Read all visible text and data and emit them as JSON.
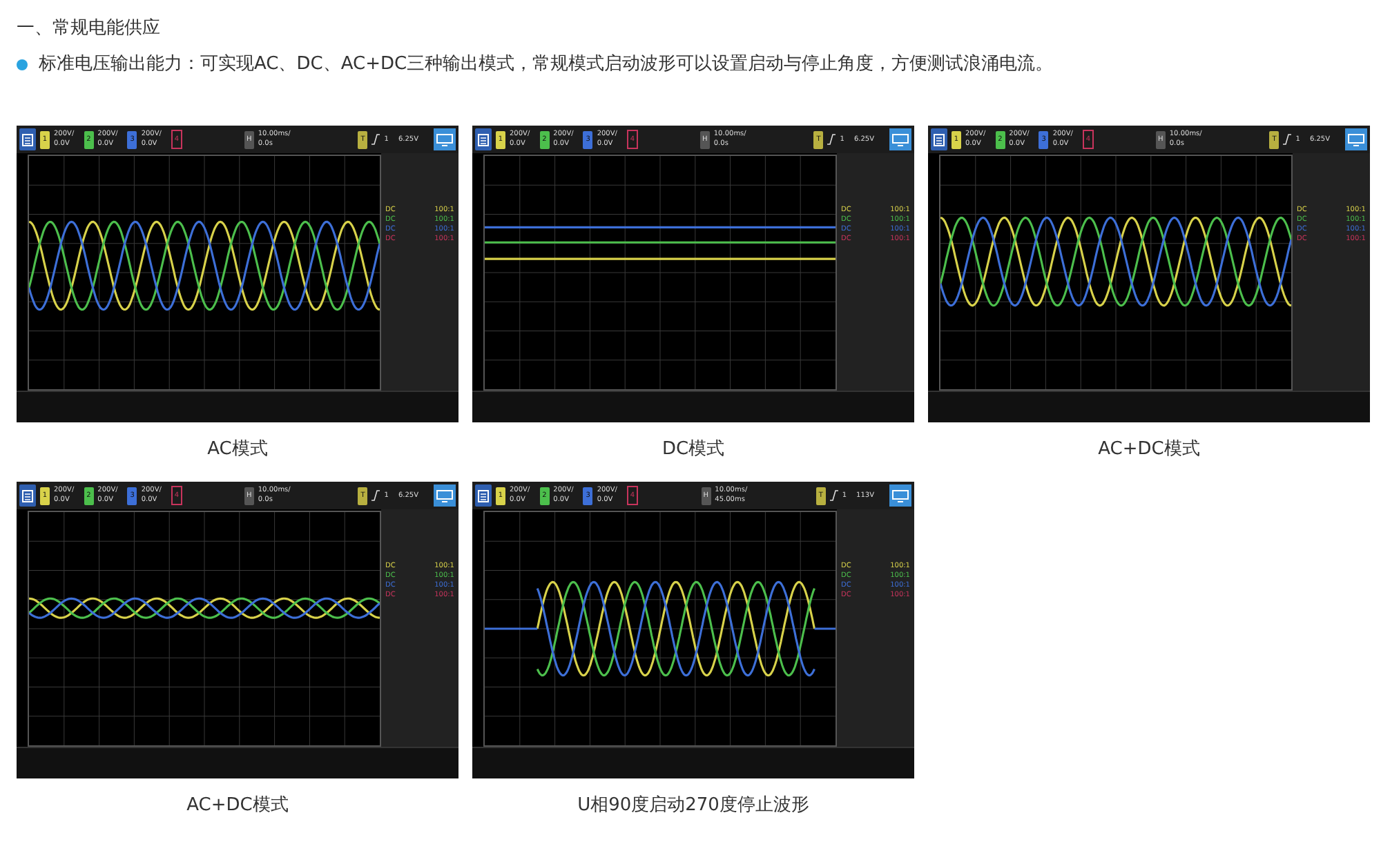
{
  "heading": "一、常规电能供应",
  "bullet": "标准电压输出能力：可实现AC、DC、AC+DC三种输出模式，常规模式启动波形可以设置启动与停止角度，方便测试浪涌电流。",
  "panels": [
    {
      "caption": "AC模式",
      "kind": "sine",
      "horizontal_key": "H",
      "trigger_key": "T",
      "channels": [
        {
          "label": "1",
          "scale": "200V/",
          "offset": "0.0V"
        },
        {
          "label": "2",
          "scale": "200V/",
          "offset": "0.0V"
        },
        {
          "label": "3",
          "scale": "200V/",
          "offset": "0.0V"
        }
      ],
      "channel_4": "4",
      "timebase": "10.00ms/",
      "delay": "0.0s",
      "trigger_source": "1",
      "trigger_level": "6.25V",
      "probes": [
        {
          "coupling": "DC",
          "ratio": "100:1",
          "color": "#d8d24a"
        },
        {
          "coupling": "DC",
          "ratio": "100:1",
          "color": "#4cbf4c"
        },
        {
          "coupling": "DC",
          "ratio": "100:1",
          "color": "#3d6fd8"
        },
        {
          "coupling": "DC",
          "ratio": "100:1",
          "color": "#c8345c"
        }
      ]
    },
    {
      "caption": "DC模式",
      "kind": "dc",
      "horizontal_key": "H",
      "trigger_key": "T",
      "channels": [
        {
          "label": "1",
          "scale": "200V/",
          "offset": "0.0V"
        },
        {
          "label": "2",
          "scale": "200V/",
          "offset": "0.0V"
        },
        {
          "label": "3",
          "scale": "200V/",
          "offset": "0.0V"
        }
      ],
      "channel_4": "4",
      "timebase": "10.00ms/",
      "delay": "0.0s",
      "trigger_source": "1",
      "trigger_level": "6.25V",
      "probes": [
        {
          "coupling": "DC",
          "ratio": "100:1",
          "color": "#d8d24a"
        },
        {
          "coupling": "DC",
          "ratio": "100:1",
          "color": "#4cbf4c"
        },
        {
          "coupling": "DC",
          "ratio": "100:1",
          "color": "#3d6fd8"
        },
        {
          "coupling": "DC",
          "ratio": "100:1",
          "color": "#c8345c"
        }
      ]
    },
    {
      "caption": "AC+DC模式",
      "kind": "offset-sine",
      "horizontal_key": "H",
      "trigger_key": "T",
      "channels": [
        {
          "label": "1",
          "scale": "200V/",
          "offset": "0.0V"
        },
        {
          "label": "2",
          "scale": "200V/",
          "offset": "0.0V"
        },
        {
          "label": "3",
          "scale": "200V/",
          "offset": "0.0V"
        }
      ],
      "channel_4": "4",
      "timebase": "10.00ms/",
      "delay": "0.0s",
      "trigger_source": "1",
      "trigger_level": "6.25V",
      "probes": [
        {
          "coupling": "DC",
          "ratio": "100:1",
          "color": "#d8d24a"
        },
        {
          "coupling": "DC",
          "ratio": "100:1",
          "color": "#4cbf4c"
        },
        {
          "coupling": "DC",
          "ratio": "100:1",
          "color": "#3d6fd8"
        },
        {
          "coupling": "DC",
          "ratio": "100:1",
          "color": "#c8345c"
        }
      ]
    },
    {
      "caption": "AC+DC模式",
      "kind": "small-sine",
      "horizontal_key": "H",
      "trigger_key": "T",
      "channels": [
        {
          "label": "1",
          "scale": "200V/",
          "offset": "0.0V"
        },
        {
          "label": "2",
          "scale": "200V/",
          "offset": "0.0V"
        },
        {
          "label": "3",
          "scale": "200V/",
          "offset": "0.0V"
        }
      ],
      "channel_4": "4",
      "timebase": "10.00ms/",
      "delay": "0.0s",
      "trigger_source": "1",
      "trigger_level": "6.25V",
      "probes": [
        {
          "coupling": "DC",
          "ratio": "100:1",
          "color": "#d8d24a"
        },
        {
          "coupling": "DC",
          "ratio": "100:1",
          "color": "#4cbf4c"
        },
        {
          "coupling": "DC",
          "ratio": "100:1",
          "color": "#3d6fd8"
        },
        {
          "coupling": "DC",
          "ratio": "100:1",
          "color": "#c8345c"
        }
      ]
    },
    {
      "caption": "U相90度启动270度停止波形",
      "kind": "burst",
      "horizontal_key": "H",
      "trigger_key": "T",
      "channels": [
        {
          "label": "1",
          "scale": "200V/",
          "offset": "0.0V"
        },
        {
          "label": "2",
          "scale": "200V/",
          "offset": "0.0V"
        },
        {
          "label": "3",
          "scale": "200V/",
          "offset": "0.0V"
        }
      ],
      "channel_4": "4",
      "timebase": "10.00ms/",
      "delay": "45.00ms",
      "trigger_source": "1",
      "trigger_level": "113V",
      "probes": [
        {
          "coupling": "DC",
          "ratio": "100:1",
          "color": "#d8d24a"
        },
        {
          "coupling": "DC",
          "ratio": "100:1",
          "color": "#4cbf4c"
        },
        {
          "coupling": "DC",
          "ratio": "100:1",
          "color": "#3d6fd8"
        },
        {
          "coupling": "DC",
          "ratio": "100:1",
          "color": "#c8345c"
        }
      ]
    }
  ]
}
